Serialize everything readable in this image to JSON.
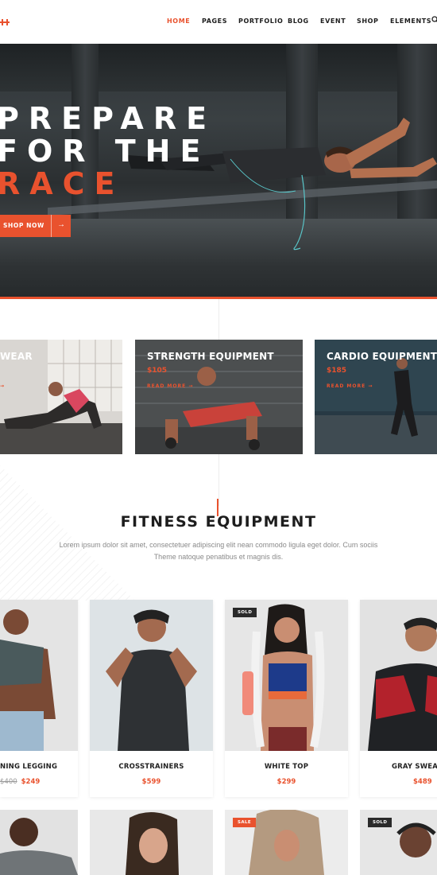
{
  "nav": {
    "items": [
      "HOME",
      "PAGES",
      "PORTFOLIO",
      "BLOG",
      "EVENT",
      "SHOP",
      "ELEMENTS"
    ],
    "active": "HOME",
    "search_icon": "search-icon"
  },
  "hero": {
    "line1": "PREPARE",
    "line2": "FOR THE",
    "line3": "RACE",
    "button_label": "SHOP NOW",
    "button_icon": "arrow-right-icon",
    "accent": "#e9522e"
  },
  "categories": [
    {
      "title": "WEAR",
      "price": "",
      "link": ""
    },
    {
      "title": "STRENGTH EQUIPMENT",
      "price": "$105",
      "link": "READ MORE"
    },
    {
      "title": "CARDIO EQUIPMENT",
      "price": "$185",
      "link": "READ MORE"
    }
  ],
  "section": {
    "title": "FITNESS EQUIPMENT",
    "desc_line1": "Lorem ipsum dolor sit amet, consectetuer adipiscing elit nean commodo ligula eget dolor. Cum sociis",
    "desc_line2": "Theme natoque penatibus et magnis dis."
  },
  "products": [
    {
      "name": "NING LEGGING",
      "old_price": "$400",
      "price": "$249",
      "badge": ""
    },
    {
      "name": "CROSSTRAINERS",
      "old_price": "",
      "price": "$599",
      "badge": ""
    },
    {
      "name": "WHITE TOP",
      "old_price": "",
      "price": "$299",
      "badge": "SOLD"
    },
    {
      "name": "GRAY SWEATSH",
      "old_price": "",
      "price": "$489",
      "badge": ""
    }
  ],
  "products_row2": [
    {
      "badge": ""
    },
    {
      "badge": ""
    },
    {
      "badge": "SALE"
    },
    {
      "badge": "SOLD"
    }
  ]
}
